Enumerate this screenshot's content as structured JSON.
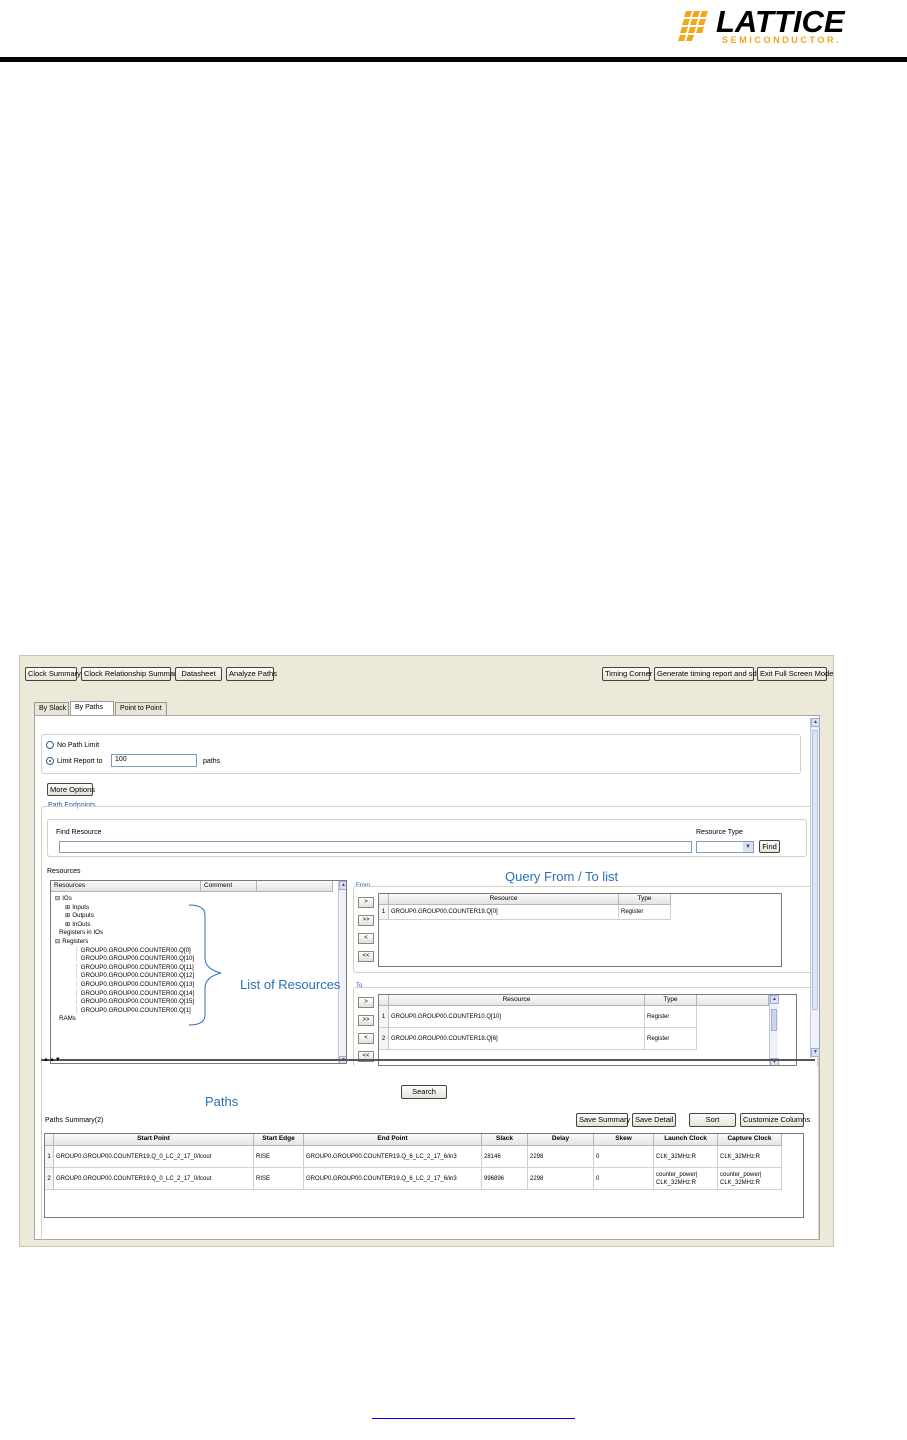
{
  "logo": {
    "word": "LATTICE",
    "sub": "SEMICONDUCTOR."
  },
  "toolbar": {
    "left": [
      "Clock Summary",
      "Clock Relationship Summary",
      "Datasheet",
      "Analyze Paths"
    ],
    "right": [
      "Timing Corner",
      "Generate timing report and sdf",
      "Exit Full Screen Mode"
    ]
  },
  "tabs": [
    "By Slack",
    "By Paths",
    "Point to Point"
  ],
  "limit": {
    "no_limit_label": "No Path Limit",
    "limit_label": "Limit Report to",
    "value": "100",
    "unit": "paths"
  },
  "more_options": "More Options",
  "endpoints": {
    "group_title": "Path Endpoints",
    "find_label": "Find Resource",
    "type_label": "Resource Type",
    "find_button": "Find"
  },
  "resources": {
    "title": "Resources",
    "col_resources": "Resources",
    "col_comment": "Comment",
    "tree": [
      {
        "sym": "⊟",
        "label": "IOs",
        "indent": 0
      },
      {
        "sym": "⊞",
        "label": "Inputs",
        "indent": 1
      },
      {
        "sym": "⊞",
        "label": "Outputs",
        "indent": 1
      },
      {
        "sym": "⊞",
        "label": "InOuts",
        "indent": 1
      },
      {
        "sym": "",
        "label": "Registers in IOs",
        "indent": 0
      },
      {
        "sym": "⊟",
        "label": "Registers",
        "indent": 0
      },
      {
        "sym": "",
        "label": "GROUP0.GROUP00.COUNTER00.Q[0]",
        "indent": 2
      },
      {
        "sym": "",
        "label": "GROUP0.GROUP00.COUNTER00.Q[10]",
        "indent": 2
      },
      {
        "sym": "",
        "label": "GROUP0.GROUP00.COUNTER00.Q[11]",
        "indent": 2
      },
      {
        "sym": "",
        "label": "GROUP0.GROUP00.COUNTER00.Q[12]",
        "indent": 2
      },
      {
        "sym": "",
        "label": "GROUP0.GROUP00.COUNTER00.Q[13]",
        "indent": 2
      },
      {
        "sym": "",
        "label": "GROUP0.GROUP00.COUNTER00.Q[14]",
        "indent": 2
      },
      {
        "sym": "",
        "label": "GROUP0.GROUP00.COUNTER00.Q[15]",
        "indent": 2
      },
      {
        "sym": "",
        "label": "GROUP0.GROUP00.COUNTER00.Q[1]",
        "indent": 2
      },
      {
        "sym": "",
        "label": "RAMs",
        "indent": 0
      }
    ]
  },
  "from": {
    "title": "From",
    "col_resource": "Resource",
    "col_type": "Type",
    "rows": [
      {
        "n": "1",
        "resource": "GROUP0.GROUP00.COUNTER19.Q[0]",
        "type": "Register"
      }
    ]
  },
  "to": {
    "title": "To",
    "col_resource": "Resource",
    "col_type": "Type",
    "rows": [
      {
        "n": "1",
        "resource": "GROUP0.GROUP00.COUNTER10.Q[10]",
        "type": "Register"
      },
      {
        "n": "2",
        "resource": "GROUP0.GROUP00.COUNTER18.Q[6]",
        "type": "Register"
      }
    ]
  },
  "shuttle": [
    ">",
    ">>",
    "<",
    "<<"
  ],
  "search_button": "Search",
  "paths": {
    "summary_label": "Paths Summary(2)",
    "buttons": [
      "Save Summary",
      "Save Detail",
      "Sort",
      "Customize Columns"
    ],
    "columns": [
      "Start Point",
      "Start Edge",
      "End Point",
      "Slack",
      "Delay",
      "Skew",
      "Launch Clock",
      "Capture Clock"
    ],
    "rows": [
      {
        "n": "1",
        "start": "GROUP0.GROUP00.COUNTER19.Q_0_LC_2_17_0/lcout",
        "edge": "RISE",
        "end": "GROUP0.GROUP00.COUNTER19.Q_6_LC_2_17_6/in3",
        "slack": "28146",
        "delay": "2298",
        "skew": "0",
        "launch": "CLK_32MHz:R",
        "capture": "CLK_32MHz:R"
      },
      {
        "n": "2",
        "start": "GROUP0.GROUP00.COUNTER19.Q_0_LC_2_17_0/lcout",
        "edge": "RISE",
        "end": "GROUP0.GROUP00.COUNTER19.Q_6_LC_2_17_6/in3",
        "slack": "996896",
        "delay": "2298",
        "skew": "0",
        "launch": "counter_power| CLK_32MHz:R",
        "capture": "counter_power| CLK_32MHz:R"
      }
    ]
  },
  "annotations": {
    "query": "Query From / To list",
    "resources": "List of Resources",
    "paths": "Paths"
  },
  "colors": {
    "accent": "#1f5db0",
    "logo_orange": "#f3a51b",
    "annotation": "#2a6fb8"
  }
}
